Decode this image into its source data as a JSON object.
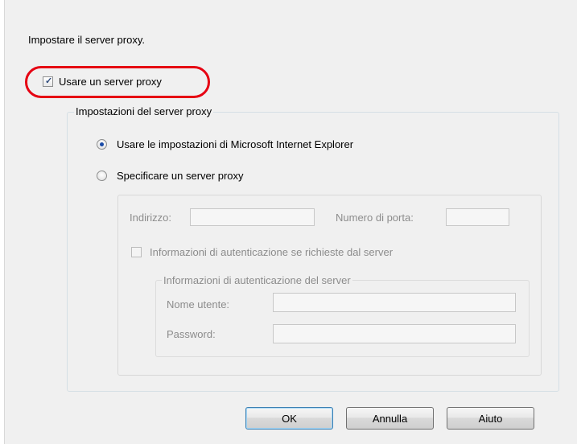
{
  "dialog": {
    "instruction": "Impostare il server proxy.",
    "use_proxy": {
      "label": "Usare un server proxy",
      "checked": true
    },
    "proxy_settings_group": {
      "title": "Impostazioni del server proxy",
      "option_ie": {
        "label": "Usare le impostazioni di Microsoft Internet Explorer",
        "selected": true
      },
      "option_specify": {
        "label": "Specificare un server proxy",
        "selected": false
      },
      "address_label": "Indirizzo:",
      "address_value": "",
      "port_label": "Numero di porta:",
      "port_value": "",
      "auth_required": {
        "label": "Informazioni di autenticazione se richieste dal server",
        "checked": false
      },
      "auth_group": {
        "title": "Informazioni di autenticazione del server",
        "username_label": "Nome utente:",
        "username_value": "",
        "password_label": "Password:",
        "password_value": ""
      }
    },
    "buttons": {
      "ok": "OK",
      "cancel": "Annulla",
      "help": "Aiuto"
    }
  },
  "annotation": {
    "highlight_color": "#e60012"
  },
  "colors": {
    "dialog_bg": "#f0f0f0",
    "disabled_text": "#8c8c8c",
    "accent": "#1a4aa6"
  }
}
